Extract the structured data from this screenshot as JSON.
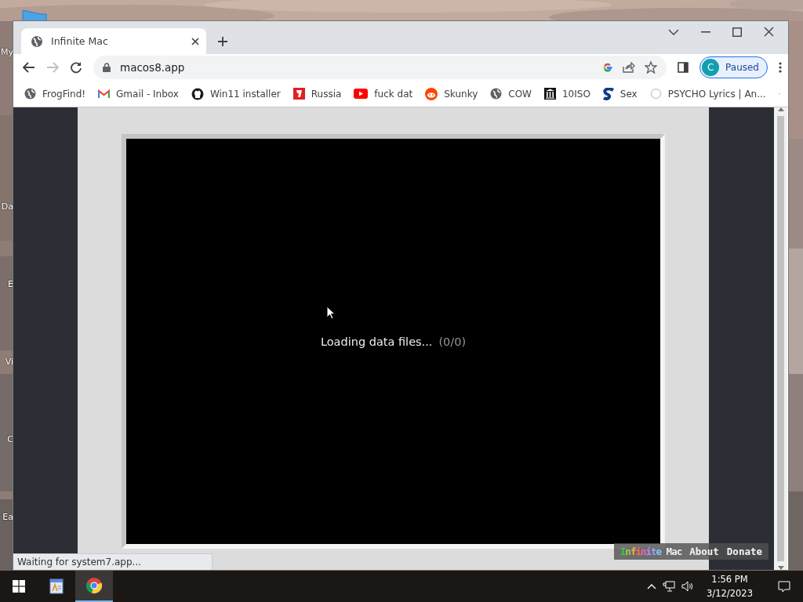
{
  "desktop": {
    "icons": [
      {
        "label": "My"
      },
      {
        "label": "Da"
      },
      {
        "label": "E"
      },
      {
        "label": "Vi"
      },
      {
        "label": "C"
      },
      {
        "label": "Ea"
      }
    ]
  },
  "browser": {
    "tabs": [
      {
        "title": "Infinite Mac",
        "selected": true
      }
    ],
    "address": "macos8.app",
    "profile": {
      "initial": "C",
      "status": "Paused"
    },
    "bookmarks": [
      {
        "label": "FrogFind!",
        "kind": "globe"
      },
      {
        "label": "Gmail - Inbox",
        "kind": "mail"
      },
      {
        "label": "Win11 installer",
        "kind": "octocat"
      },
      {
        "label": "Russia",
        "kind": "square"
      },
      {
        "label": "fuck dat",
        "kind": "play"
      },
      {
        "label": "Skunky",
        "kind": "alien"
      },
      {
        "label": "COW",
        "kind": "globe"
      },
      {
        "label": "10ISO",
        "kind": "columns"
      },
      {
        "label": "Sex",
        "kind": "sletter"
      },
      {
        "label": "PSYCHO Lyrics | An...",
        "kind": "ring"
      }
    ],
    "page": {
      "message": "Loading data files...",
      "progress": "(0/0)",
      "footer": [
        {
          "label": "Infinite Mac",
          "kind": "logo"
        },
        {
          "label": "About",
          "kind": "link"
        },
        {
          "label": "Donate",
          "kind": "link"
        }
      ]
    },
    "status_bar": "Waiting for system7.app..."
  },
  "taskbar": {
    "time": "1:56 PM",
    "date": "3/12/2023"
  }
}
